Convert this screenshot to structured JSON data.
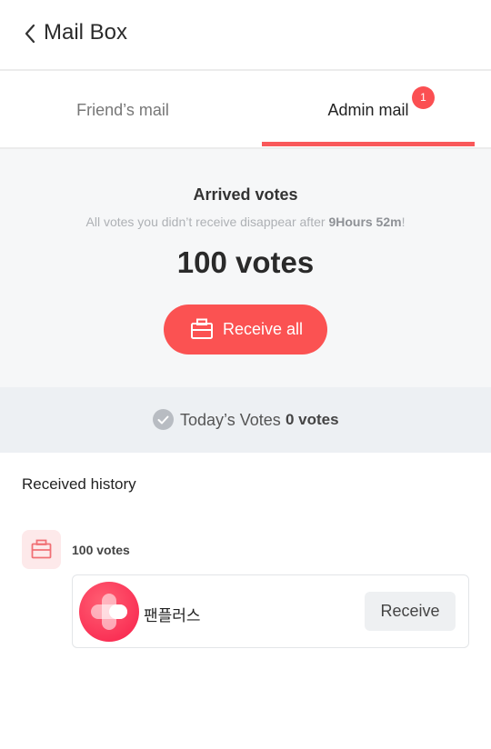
{
  "header": {
    "title": "Mail Box"
  },
  "tabs": [
    {
      "label": "Friend’s mail",
      "active": false
    },
    {
      "label": "Admin mail",
      "active": true,
      "badge": "1"
    }
  ],
  "summary": {
    "title": "Arrived votes",
    "subtitle_prefix": "All votes you didn’t receive disappear after ",
    "subtitle_time": "9Hours 52m",
    "subtitle_suffix": "!",
    "total": "100 votes",
    "receive_all_label": "Receive all"
  },
  "today": {
    "label": "Today’s Votes",
    "value": "0 votes"
  },
  "history": {
    "title": "Received history",
    "items": [
      {
        "votes": "100 votes",
        "sender": "팬플러스",
        "action_label": "Receive"
      }
    ]
  },
  "colors": {
    "accent": "#fb5252",
    "badge": "#fb4f52",
    "summary_bg": "#f6f7f8",
    "today_bg": "#edf0f3"
  },
  "icons": {
    "back": "chevron-left-icon",
    "mailbox": "mailbox-icon",
    "check": "check-circle-icon",
    "logo": "fanplus-logo-icon"
  }
}
